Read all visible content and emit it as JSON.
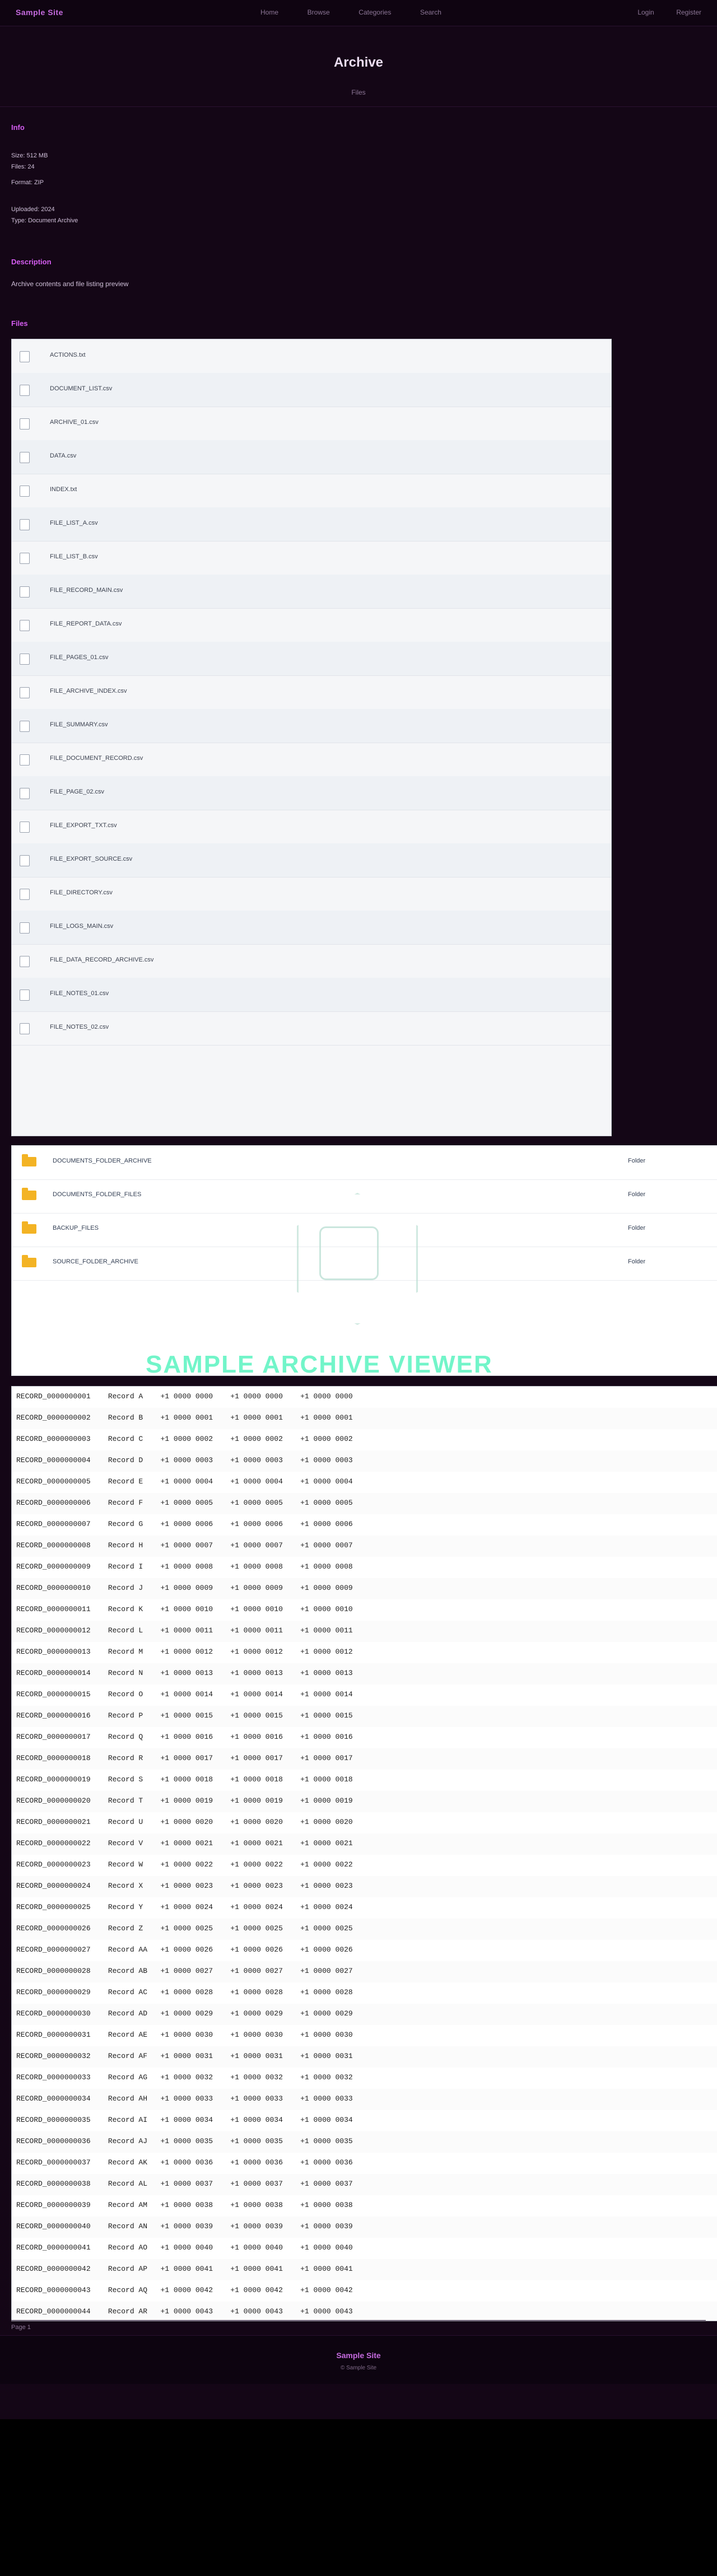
{
  "nav": {
    "brand": "Sample Site",
    "links": [
      "Home",
      "Browse",
      "Categories",
      "Search"
    ],
    "actions": [
      "Login",
      "Register"
    ]
  },
  "hero": {
    "title": "Archive",
    "subtitle": "Files"
  },
  "sections": {
    "info_title": "Info",
    "info_lines": [
      "Size: 512 MB",
      "Files: 24",
      "Format: ZIP",
      "Uploaded: 2024",
      "Type: Document Archive"
    ],
    "description_title": "Description",
    "description": "Archive contents and file listing preview",
    "files_title": "Files"
  },
  "files": [
    "ACTIONS.txt",
    "DOCUMENT_LIST.csv",
    "ARCHIVE_01.csv",
    "DATA.csv",
    "INDEX.txt",
    "FILE_LIST_A.csv",
    "FILE_LIST_B.csv",
    "FILE_RECORD_MAIN.csv",
    "FILE_REPORT_DATA.csv",
    "FILE_PAGES_01.csv",
    "FILE_ARCHIVE_INDEX.csv",
    "FILE_SUMMARY.csv",
    "FILE_DOCUMENT_RECORD.csv",
    "FILE_PAGE_02.csv",
    "FILE_EXPORT_TXT.csv",
    "FILE_EXPORT_SOURCE.csv",
    "FILE_DIRECTORY.csv",
    "FILE_LOGS_MAIN.csv",
    "FILE_DATA_RECORD_ARCHIVE.csv",
    "FILE_NOTES_01.csv",
    "FILE_NOTES_02.csv"
  ],
  "folders": [
    {
      "name": "DOCUMENTS_FOLDER_ARCHIVE",
      "type": "Folder"
    },
    {
      "name": "DOCUMENTS_FOLDER_FILES",
      "type": "Folder"
    },
    {
      "name": "BACKUP_FILES",
      "type": "Folder"
    },
    {
      "name": "SOURCE_FOLDER_ARCHIVE",
      "type": "Folder"
    }
  ],
  "watermark": {
    "text": "SAMPLE ARCHIVE VIEWER"
  },
  "log_rows": [
    "RECORD_0000000001    Record A    +1 0000 0000    +1 0000 0000    +1 0000 0000",
    "RECORD_0000000002    Record B    +1 0000 0001    +1 0000 0001    +1 0000 0001",
    "RECORD_0000000003    Record C    +1 0000 0002    +1 0000 0002    +1 0000 0002",
    "RECORD_0000000004    Record D    +1 0000 0003    +1 0000 0003    +1 0000 0003",
    "RECORD_0000000005    Record E    +1 0000 0004    +1 0000 0004    +1 0000 0004",
    "RECORD_0000000006    Record F    +1 0000 0005    +1 0000 0005    +1 0000 0005",
    "RECORD_0000000007    Record G    +1 0000 0006    +1 0000 0006    +1 0000 0006",
    "RECORD_0000000008    Record H    +1 0000 0007    +1 0000 0007    +1 0000 0007",
    "RECORD_0000000009    Record I    +1 0000 0008    +1 0000 0008    +1 0000 0008",
    "RECORD_0000000010    Record J    +1 0000 0009    +1 0000 0009    +1 0000 0009",
    "RECORD_0000000011    Record K    +1 0000 0010    +1 0000 0010    +1 0000 0010",
    "RECORD_0000000012    Record L    +1 0000 0011    +1 0000 0011    +1 0000 0011",
    "RECORD_0000000013    Record M    +1 0000 0012    +1 0000 0012    +1 0000 0012",
    "RECORD_0000000014    Record N    +1 0000 0013    +1 0000 0013    +1 0000 0013",
    "RECORD_0000000015    Record O    +1 0000 0014    +1 0000 0014    +1 0000 0014",
    "RECORD_0000000016    Record P    +1 0000 0015    +1 0000 0015    +1 0000 0015",
    "RECORD_0000000017    Record Q    +1 0000 0016    +1 0000 0016    +1 0000 0016",
    "RECORD_0000000018    Record R    +1 0000 0017    +1 0000 0017    +1 0000 0017",
    "RECORD_0000000019    Record S    +1 0000 0018    +1 0000 0018    +1 0000 0018",
    "RECORD_0000000020    Record T    +1 0000 0019    +1 0000 0019    +1 0000 0019",
    "RECORD_0000000021    Record U    +1 0000 0020    +1 0000 0020    +1 0000 0020",
    "RECORD_0000000022    Record V    +1 0000 0021    +1 0000 0021    +1 0000 0021",
    "RECORD_0000000023    Record W    +1 0000 0022    +1 0000 0022    +1 0000 0022",
    "RECORD_0000000024    Record X    +1 0000 0023    +1 0000 0023    +1 0000 0023",
    "RECORD_0000000025    Record Y    +1 0000 0024    +1 0000 0024    +1 0000 0024",
    "RECORD_0000000026    Record Z    +1 0000 0025    +1 0000 0025    +1 0000 0025",
    "RECORD_0000000027    Record AA   +1 0000 0026    +1 0000 0026    +1 0000 0026",
    "RECORD_0000000028    Record AB   +1 0000 0027    +1 0000 0027    +1 0000 0027",
    "RECORD_0000000029    Record AC   +1 0000 0028    +1 0000 0028    +1 0000 0028",
    "RECORD_0000000030    Record AD   +1 0000 0029    +1 0000 0029    +1 0000 0029",
    "RECORD_0000000031    Record AE   +1 0000 0030    +1 0000 0030    +1 0000 0030",
    "RECORD_0000000032    Record AF   +1 0000 0031    +1 0000 0031    +1 0000 0031",
    "RECORD_0000000033    Record AG   +1 0000 0032    +1 0000 0032    +1 0000 0032",
    "RECORD_0000000034    Record AH   +1 0000 0033    +1 0000 0033    +1 0000 0033",
    "RECORD_0000000035    Record AI   +1 0000 0034    +1 0000 0034    +1 0000 0034",
    "RECORD_0000000036    Record AJ   +1 0000 0035    +1 0000 0035    +1 0000 0035",
    "RECORD_0000000037    Record AK   +1 0000 0036    +1 0000 0036    +1 0000 0036",
    "RECORD_0000000038    Record AL   +1 0000 0037    +1 0000 0037    +1 0000 0037",
    "RECORD_0000000039    Record AM   +1 0000 0038    +1 0000 0038    +1 0000 0038",
    "RECORD_0000000040    Record AN   +1 0000 0039    +1 0000 0039    +1 0000 0039",
    "RECORD_0000000041    Record AO   +1 0000 0040    +1 0000 0040    +1 0000 0040",
    "RECORD_0000000042    Record AP   +1 0000 0041    +1 0000 0041    +1 0000 0041",
    "RECORD_0000000043    Record AQ   +1 0000 0042    +1 0000 0042    +1 0000 0042",
    "RECORD_0000000044    Record AR   +1 0000 0043    +1 0000 0043    +1 0000 0043"
  ],
  "footer": {
    "page_tag": "Page 1",
    "brand": "Sample Site",
    "copy": "© Sample Site"
  }
}
